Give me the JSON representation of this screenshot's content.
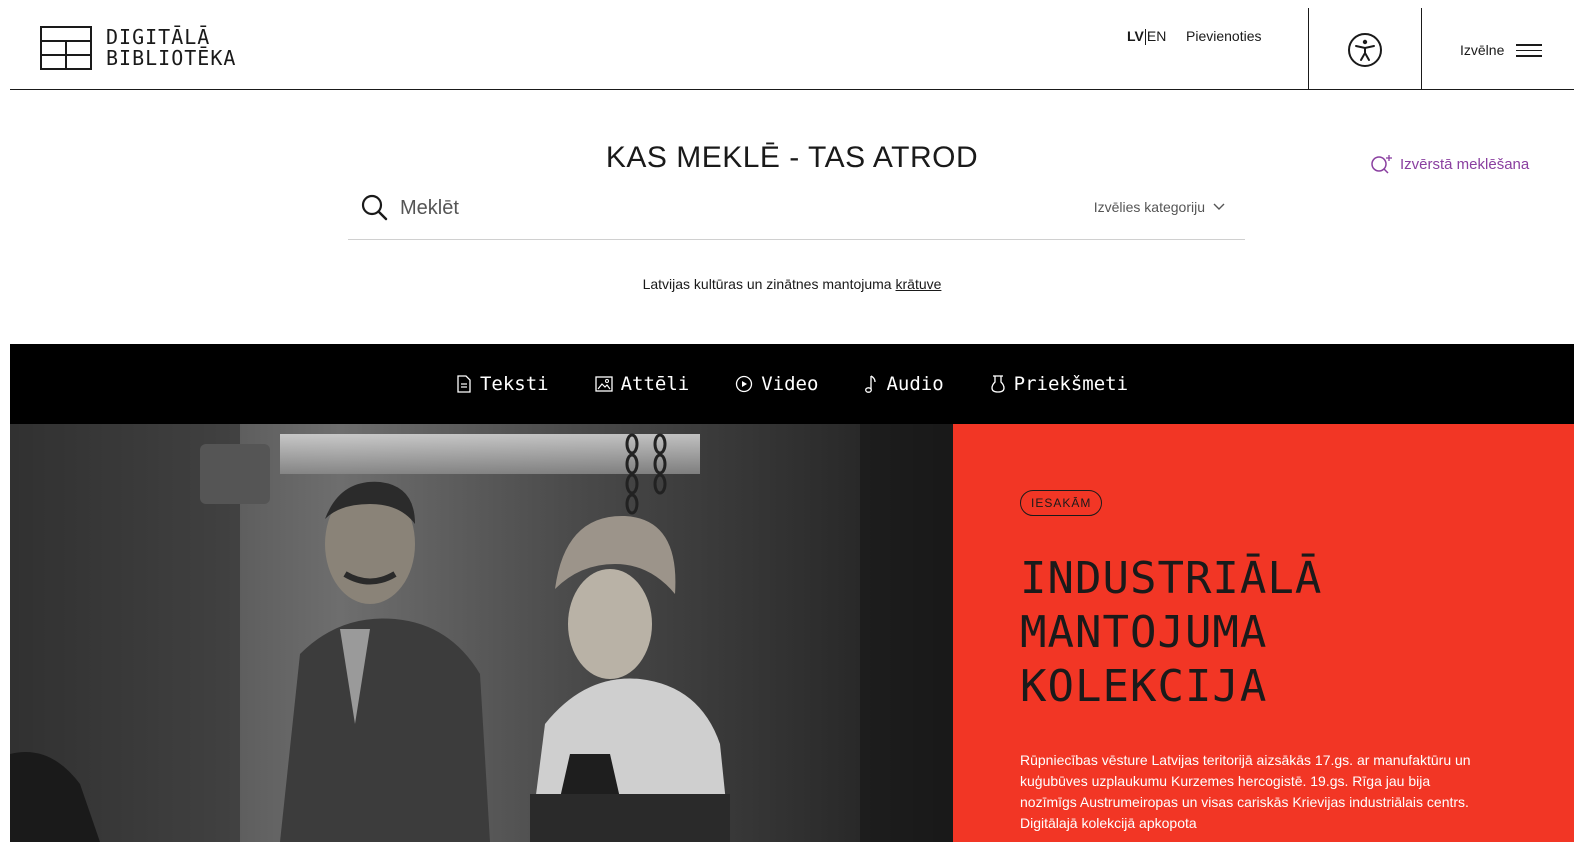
{
  "header": {
    "logo_line1": "DIGITĀLĀ",
    "logo_line2": "BIBLIOTĒKA",
    "lang_active": "LV",
    "lang_other": "EN",
    "join_label": "Pievienoties",
    "accessibility_icon": "accessibility-icon",
    "menu_label": "Izvēlne",
    "menu_icon": "hamburger-icon"
  },
  "search": {
    "slogan": "KAS MEKLĒ - TAS ATROD",
    "advanced_label": "Izvērstā meklēšana",
    "placeholder": "Meklēt",
    "category_label": "Izvēlies kategoriju",
    "tagline_prefix": "Latvijas kultūras un zinātnes mantojuma",
    "tagline_link": "krātuve"
  },
  "nav": {
    "items": [
      {
        "label": "Teksti",
        "icon": "document-icon"
      },
      {
        "label": "Attēli",
        "icon": "image-icon"
      },
      {
        "label": "Video",
        "icon": "play-icon"
      },
      {
        "label": "Audio",
        "icon": "music-note-icon"
      },
      {
        "label": "Priekšmeti",
        "icon": "object-icon"
      }
    ]
  },
  "hero": {
    "badge": "IESAKĀM",
    "title_lines": [
      "INDUSTRIĀLĀ",
      "MANTOJUMA",
      "KOLEKCIJA"
    ],
    "text": "Rūpniecības vēsture Latvijas teritorijā aizsākās 17.gs. ar manufaktūru un kuģubūves uzplaukumu Kurzemes hercogistē. 19.gs. Rīga jau bija nozīmīgs Austrumeiropas un visas cariskās Krievijas industriālais centrs. Digitālajā kolekcijā apkopota",
    "colors": {
      "panel": "#f23625",
      "text": "#ffffff"
    }
  },
  "colors": {
    "accent": "#8a3fa0",
    "nav_bg": "#000000"
  }
}
